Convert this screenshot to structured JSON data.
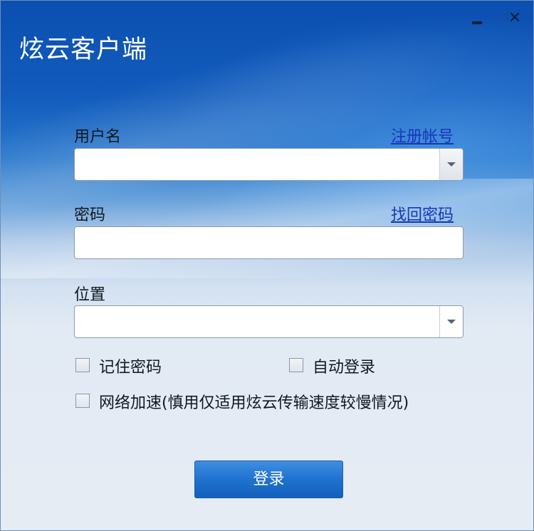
{
  "window": {
    "title": "炫云客户端",
    "minimize_icon": "minimize-icon",
    "close_icon": "close-icon",
    "close_glyph": "✕"
  },
  "form": {
    "username_label": "用户名",
    "register_link": "注册帐号",
    "username_value": "",
    "password_label": "密码",
    "recover_link": "找回密码",
    "password_value": "",
    "location_label": "位置",
    "location_value": "",
    "remember_password_label": "记住密码",
    "remember_password_checked": false,
    "auto_login_label": "自动登录",
    "auto_login_checked": false,
    "network_accel_label": "网络加速(慎用仅适用炫云传输速度较慢情况)",
    "network_accel_checked": false,
    "login_button": "登录"
  },
  "colors": {
    "header_blue": "#0b4fb0",
    "body_bg": "#e6ecf4",
    "link": "#1637b8",
    "button": "#1f72cf"
  }
}
